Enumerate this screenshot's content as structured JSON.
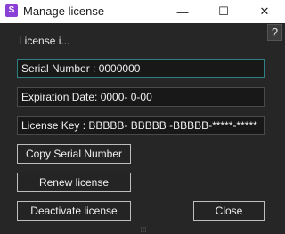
{
  "window": {
    "title": "Manage license",
    "app_icon": "S",
    "minimize_glyph": "—",
    "maximize_glyph": "☐",
    "close_glyph": "✕"
  },
  "help": {
    "label": "?"
  },
  "section": {
    "label": "License i..."
  },
  "fields": {
    "serial": "Serial Number : 0000000",
    "expiration": "Expiration Date: 0000- 0-00",
    "license_key": "License Key : BBBBB- BBBBB -BBBBB-*****-*****"
  },
  "buttons": {
    "copy_serial": "Copy Serial Number",
    "renew": "Renew license",
    "deactivate": "Deactivate license",
    "close": "Close"
  },
  "grip": "⁞⁞⁞",
  "colors": {
    "background": "#262626",
    "titlebar": "#ffffff",
    "accent_focus": "#2f7f85",
    "app_icon": "#8a3fd6"
  }
}
